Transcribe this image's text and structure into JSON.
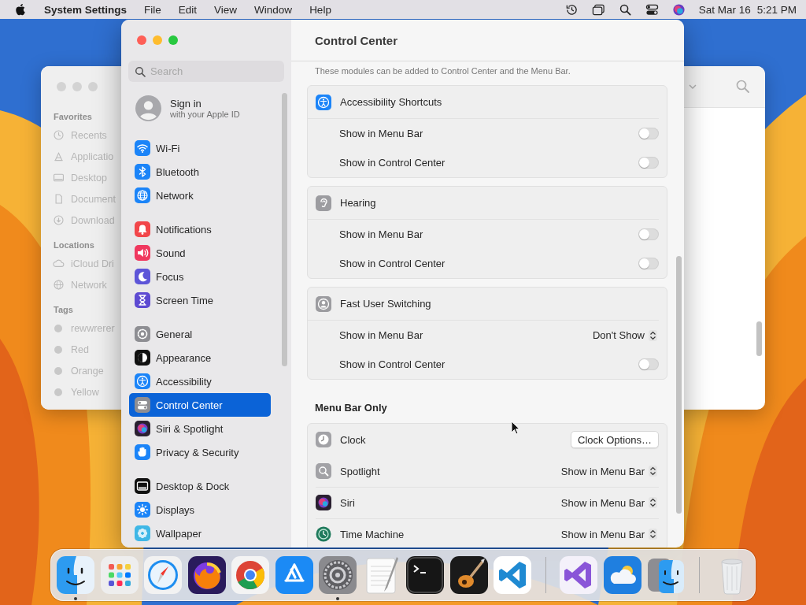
{
  "menu_bar": {
    "app_name": "System Settings",
    "menus": [
      "File",
      "Edit",
      "View",
      "Window",
      "Help"
    ],
    "date": "Sat Mar 16",
    "time": "5:21 PM"
  },
  "finder": {
    "sections": [
      {
        "title": "Favorites",
        "kind": "places",
        "items": [
          "Recents",
          "Applicatio",
          "Desktop",
          "Document",
          "Download"
        ]
      },
      {
        "title": "Locations",
        "kind": "places",
        "items": [
          "iCloud Dri",
          "Network"
        ]
      },
      {
        "title": "Tags",
        "kind": "tags",
        "items": [
          "rewwrerer",
          "Red",
          "Orange",
          "Yellow"
        ]
      }
    ]
  },
  "settings": {
    "search": {
      "placeholder": "Search"
    },
    "account": {
      "title": "Sign in",
      "subtitle": "with your Apple ID"
    },
    "groups": [
      {
        "items": [
          {
            "label": "Wi-Fi",
            "selected": false
          },
          {
            "label": "Bluetooth",
            "selected": false
          },
          {
            "label": "Network",
            "selected": false
          }
        ]
      },
      {
        "items": [
          {
            "label": "Notifications",
            "selected": false
          },
          {
            "label": "Sound",
            "selected": false
          },
          {
            "label": "Focus",
            "selected": false
          },
          {
            "label": "Screen Time",
            "selected": false
          }
        ]
      },
      {
        "items": [
          {
            "label": "General",
            "selected": false
          },
          {
            "label": "Appearance",
            "selected": false
          },
          {
            "label": "Accessibility",
            "selected": false
          },
          {
            "label": "Control Center",
            "selected": true
          },
          {
            "label": "Siri & Spotlight",
            "selected": false
          },
          {
            "label": "Privacy & Security",
            "selected": false
          }
        ]
      },
      {
        "items": [
          {
            "label": "Desktop & Dock",
            "selected": false
          },
          {
            "label": "Displays",
            "selected": false
          },
          {
            "label": "Wallpaper",
            "selected": false
          }
        ]
      }
    ],
    "title": "Control Center",
    "subtitle": "These modules can be added to Control Center and the Menu Bar.",
    "modules": [
      {
        "name": "Accessibility Shortcuts",
        "rows": [
          {
            "label": "Show in Menu Bar",
            "kind": "toggle",
            "on": false
          },
          {
            "label": "Show in Control Center",
            "kind": "toggle",
            "on": false
          }
        ]
      },
      {
        "name": "Hearing",
        "rows": [
          {
            "label": "Show in Menu Bar",
            "kind": "toggle",
            "on": false
          },
          {
            "label": "Show in Control Center",
            "kind": "toggle",
            "on": false
          }
        ]
      },
      {
        "name": "Fast User Switching",
        "rows": [
          {
            "label": "Show in Menu Bar",
            "kind": "popup",
            "value": "Don't Show"
          },
          {
            "label": "Show in Control Center",
            "kind": "toggle",
            "on": false
          }
        ]
      }
    ],
    "menu_bar_only": {
      "title": "Menu Bar Only",
      "rows": [
        {
          "name": "Clock",
          "kind": "button",
          "value": "Clock Options…"
        },
        {
          "name": "Spotlight",
          "kind": "popup",
          "value": "Show in Menu Bar"
        },
        {
          "name": "Siri",
          "kind": "popup",
          "value": "Show in Menu Bar"
        },
        {
          "name": "Time Machine",
          "kind": "popup",
          "value": "Show in Menu Bar"
        }
      ]
    }
  },
  "dock": {
    "apps": [
      {
        "running": true
      },
      {
        "running": false
      },
      {
        "running": false
      },
      {
        "running": false
      },
      {
        "running": false
      },
      {
        "running": false
      },
      {
        "running": true
      },
      {
        "running": false
      },
      {
        "running": false
      },
      {
        "running": false
      },
      {
        "running": false
      }
    ],
    "others": [
      {
        "running": false
      },
      {
        "running": false
      },
      {
        "running": false
      }
    ]
  }
}
